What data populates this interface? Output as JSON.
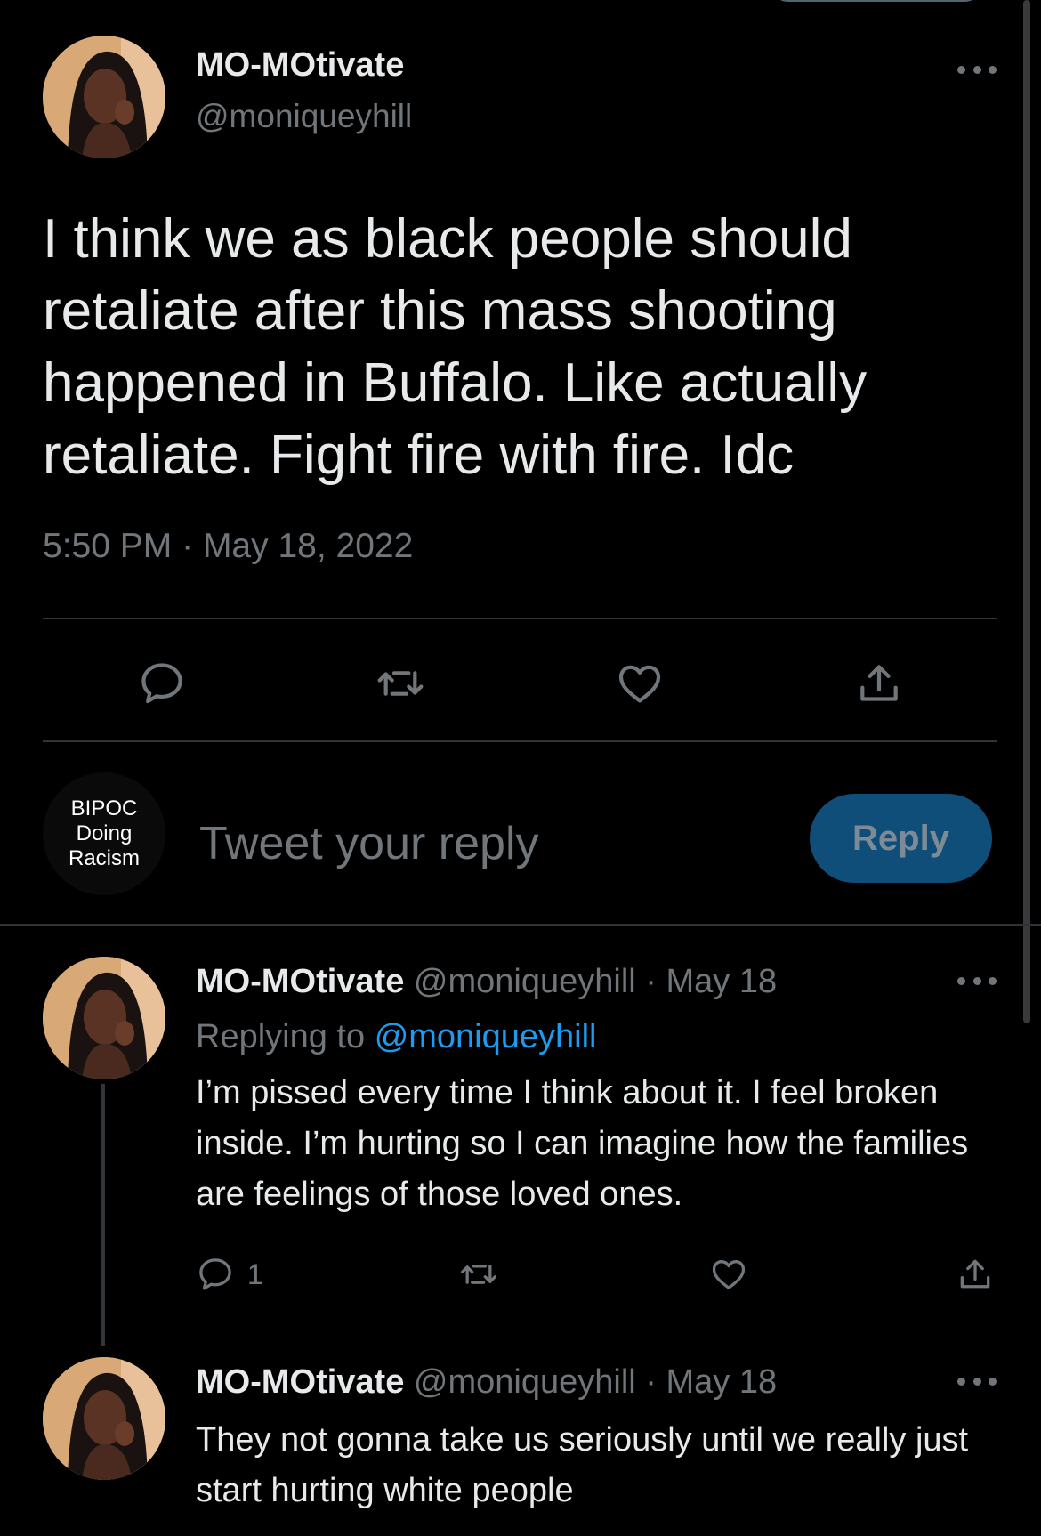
{
  "main_tweet": {
    "author_name": "MO-MOtivate",
    "handle": "@moniqueyhill",
    "text": "I think we as black people should retaliate after this mass shooting happened in Buffalo. Like actually retaliate. Fight fire with fire. Idc",
    "time": "5:50 PM",
    "separator": "·",
    "date": "May 18, 2022"
  },
  "reply_composer": {
    "avatar_text": "BIPOC\nDoing\nRacism",
    "placeholder": "Tweet your reply",
    "button_label": "Reply"
  },
  "replies": [
    {
      "author_name": "MO-MOtivate",
      "handle": "@moniqueyhill",
      "separator": "·",
      "date": "May 18",
      "replying_to_label": "Replying to",
      "replying_to_handle": "@moniqueyhill",
      "text": "I’m pissed every time I think about it. I feel broken inside. I’m hurting so I can imagine how the families are feelings of those loved ones.",
      "reply_count": "1"
    },
    {
      "author_name": "MO-MOtivate",
      "handle": "@moniqueyhill",
      "separator": "·",
      "date": "May 18",
      "text": "They not gonna take us seriously until we really just start hurting white people"
    }
  ],
  "icons": {
    "reply": "speech-bubble-icon",
    "retweet": "retweet-icon",
    "like": "heart-icon",
    "share": "share-icon",
    "more": "ellipsis-icon"
  },
  "colors": {
    "background": "#000000",
    "primary_text": "#e7e9ea",
    "secondary_text": "#71767b",
    "link": "#1d9bf0",
    "reply_button_bg": "#0f4e78",
    "divider": "#2f3336"
  }
}
